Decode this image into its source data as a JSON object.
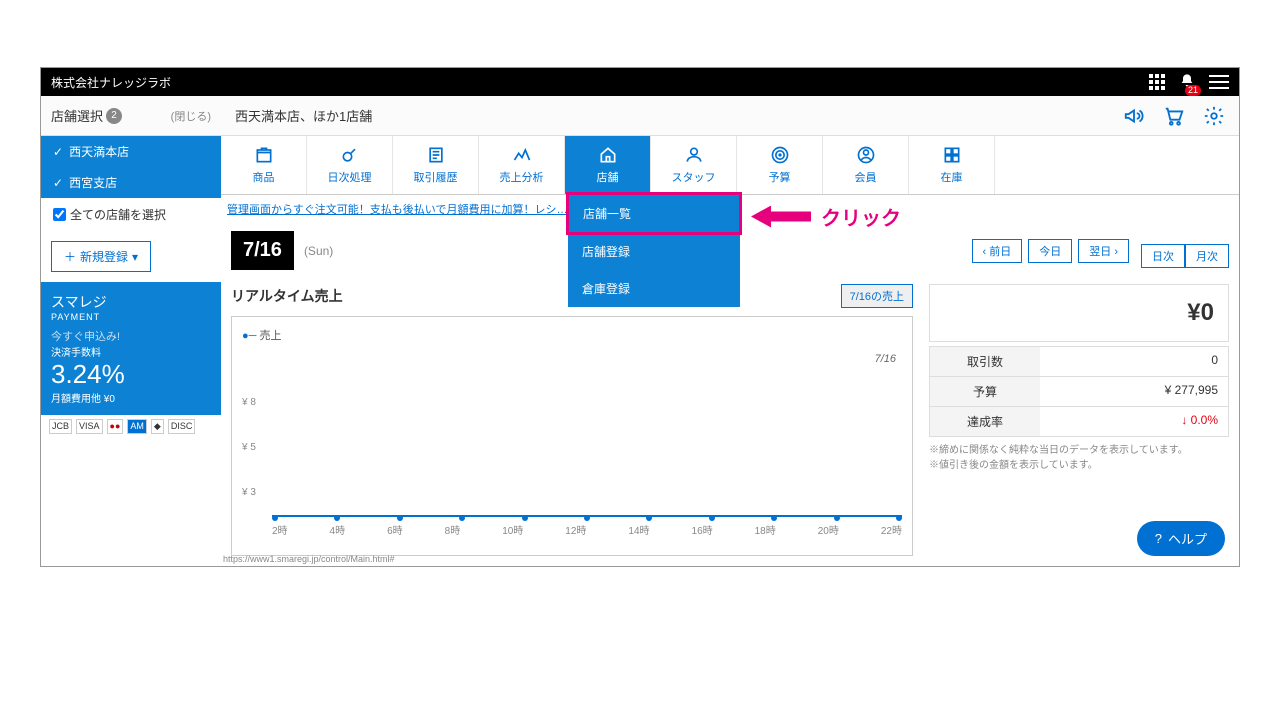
{
  "company": "株式会社ナレッジラボ",
  "notif_count": "21",
  "store_select": {
    "label": "店舗選択",
    "count": "2",
    "close": "(閉じる)"
  },
  "stores_header": "西天満本店、ほか1店舗",
  "selected_stores": [
    "西天満本店",
    "西宮支店"
  ],
  "all_stores": "全ての店舗を選択",
  "add_new": "新規登録",
  "promo": {
    "name": "スマレジ",
    "sub": "PAYMENT",
    "apply": "今すぐ申込み!",
    "fee_label": "決済手数料",
    "rate": "3.24%",
    "monthly": "月額費用他 ¥0"
  },
  "tabs": [
    "商品",
    "日次処理",
    "取引履歴",
    "売上分析",
    "店舗",
    "スタッフ",
    "予算",
    "会員",
    "在庫"
  ],
  "dropdown": [
    "店舗一覧",
    "店舗登録",
    "倉庫登録"
  ],
  "annot": "クリック",
  "promo_link": "管理画面からすぐ注文可能！支払も後払いで月額費用に加算！レシ…",
  "date": "7/16",
  "dow": "(Sun)",
  "nav_prev": "前日",
  "nav_today": "今日",
  "nav_next": "翌日",
  "view_daily": "日次",
  "view_monthly": "月次",
  "rt_title": "リアルタイム売上",
  "rt_btn": "7/16の売上",
  "legend": "売上",
  "chart_day": "7/16",
  "yticks": [
    "¥ 8",
    "¥ 5",
    "¥ 3"
  ],
  "xticks": [
    "2時",
    "4時",
    "6時",
    "8時",
    "10時",
    "12時",
    "14時",
    "16時",
    "18時",
    "20時",
    "22時"
  ],
  "total": "¥0",
  "kpi": [
    {
      "l": "取引数",
      "v": "0"
    },
    {
      "l": "予算",
      "v": "¥ 277,995"
    },
    {
      "l": "達成率",
      "v": "↓ 0.0%",
      "red": true
    }
  ],
  "notes": [
    "※締めに関係なく純粋な当日のデータを表示しています。",
    "※値引き後の金額を表示しています。"
  ],
  "help": "ヘルプ",
  "url": "https://www1.smaregi.jp/control/Main.html#",
  "chart_data": {
    "type": "line",
    "title": "リアルタイム売上",
    "series": [
      {
        "name": "売上",
        "values": [
          0,
          0,
          0,
          0,
          0,
          0,
          0,
          0,
          0,
          0,
          0
        ]
      }
    ],
    "categories": [
      "2時",
      "4時",
      "6時",
      "8時",
      "10時",
      "12時",
      "14時",
      "16時",
      "18時",
      "20時",
      "22時"
    ],
    "ylabel": "¥",
    "ylim": [
      0,
      8
    ]
  }
}
